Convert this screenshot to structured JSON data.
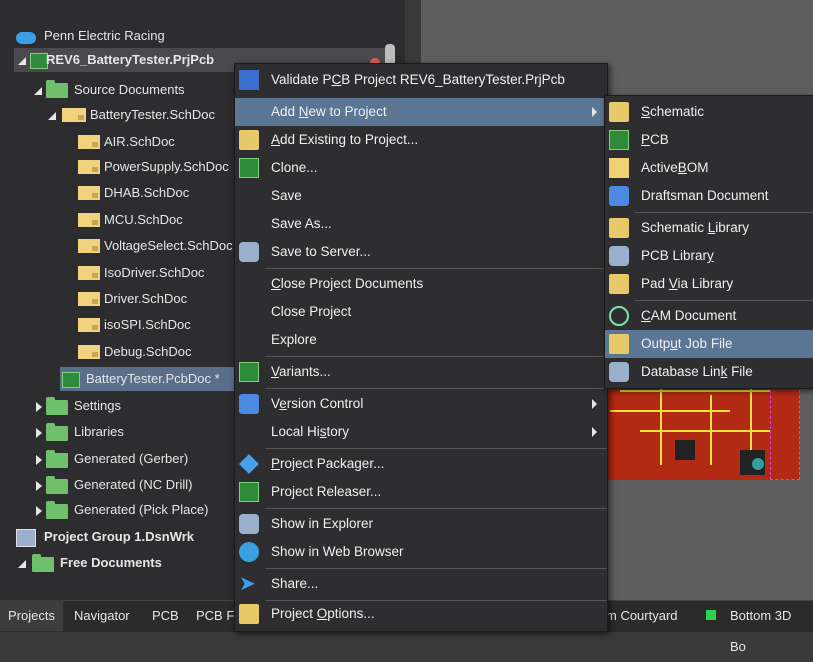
{
  "tree": {
    "workspace": "Penn Electric Racing",
    "project": "REV6_BatteryTester.PrjPcb",
    "source_documents": "Source Documents",
    "top_sheet": "BatteryTester.SchDoc",
    "sheets": [
      "AIR.SchDoc",
      "PowerSupply.SchDoc",
      "DHAB.SchDoc",
      "MCU.SchDoc",
      "VoltageSelect.SchDoc",
      "IsoDriver.SchDoc",
      "Driver.SchDoc",
      "isoSPI.SchDoc",
      "Debug.SchDoc"
    ],
    "pcb_doc": "BatteryTester.PcbDoc *",
    "folders": [
      "Settings",
      "Libraries",
      "Generated (Gerber)",
      "Generated (NC Drill)",
      "Generated (Pick Place)"
    ],
    "project_group": "Project Group 1.DsnWrk",
    "free_documents": "Free Documents"
  },
  "context_menu": {
    "items": [
      {
        "label_pre": "Validate P",
        "label_u": "C",
        "label_post": "B Project REV6_BatteryTester.PrjPcb",
        "icon": "validate-icon"
      },
      {
        "label_pre": "Add ",
        "label_u": "N",
        "label_post": "ew to Project",
        "icon": "",
        "submenu": true
      },
      {
        "label_pre": "",
        "label_u": "A",
        "label_post": "dd Existing to Project...",
        "icon": "add-existing-icon"
      },
      {
        "label_pre": "",
        "label_u": "",
        "label_post": "Clone...",
        "icon": "clone-icon"
      },
      {
        "label_pre": "",
        "label_u": "",
        "label_post": "Save",
        "icon": ""
      },
      {
        "label_pre": "",
        "label_u": "",
        "label_post": "Save As...",
        "icon": ""
      },
      {
        "label_pre": "",
        "label_u": "",
        "label_post": "Save to Server...",
        "icon": "save-server-icon"
      },
      {
        "label_pre": "",
        "label_u": "C",
        "label_post": "lose Project Documents",
        "icon": ""
      },
      {
        "label_pre": "",
        "label_u": "",
        "label_post": "Close Project",
        "icon": ""
      },
      {
        "label_pre": "",
        "label_u": "",
        "label_post": "Explore",
        "icon": ""
      },
      {
        "label_pre": "",
        "label_u": "V",
        "label_post": "ariants...",
        "icon": "variants-icon"
      },
      {
        "label_pre": "V",
        "label_u": "e",
        "label_post": "rsion Control",
        "icon": "version-control-icon",
        "submenu": true
      },
      {
        "label_pre": "Local Hi",
        "label_u": "s",
        "label_post": "tory",
        "icon": "",
        "submenu": true
      },
      {
        "label_pre": "",
        "label_u": "P",
        "label_post": "roject Packager...",
        "icon": "packager-icon"
      },
      {
        "label_pre": "Project Releaser...",
        "label_u": "",
        "label_post": "",
        "icon": "releaser-icon"
      },
      {
        "label_pre": "Show in Explorer",
        "label_u": "",
        "label_post": "",
        "icon": "explorer-icon"
      },
      {
        "label_pre": "Show in Web Browser",
        "label_u": "",
        "label_post": "",
        "icon": "web-browser-icon"
      },
      {
        "label_pre": "Share...",
        "label_u": "",
        "label_post": "",
        "icon": "share-icon"
      },
      {
        "label_pre": "Project ",
        "label_u": "O",
        "label_post": "ptions...",
        "icon": "options-icon"
      }
    ]
  },
  "submenu": {
    "items": [
      {
        "label_pre": "",
        "label_u": "S",
        "label_post": "chematic",
        "icon": "schematic-icon"
      },
      {
        "label_pre": "",
        "label_u": "P",
        "label_post": "CB",
        "icon": "pcb-icon"
      },
      {
        "label_pre": "Active",
        "label_u": "B",
        "label_post": "OM",
        "icon": "activebom-icon"
      },
      {
        "label_pre": "Draftsman Document",
        "label_u": "",
        "label_post": "",
        "icon": "draftsman-icon"
      },
      {
        "label_pre": "Schematic ",
        "label_u": "L",
        "label_post": "ibrary",
        "icon": "schlib-icon"
      },
      {
        "label_pre": "PCB Librar",
        "label_u": "y",
        "label_post": "",
        "icon": "pcblib-icon"
      },
      {
        "label_pre": "Pad ",
        "label_u": "V",
        "label_post": "ia Library",
        "icon": "padvia-icon"
      },
      {
        "label_pre": "",
        "label_u": "C",
        "label_post": "AM Document",
        "icon": "cam-icon"
      },
      {
        "label_pre": "Outp",
        "label_u": "u",
        "label_post": "t Job File",
        "icon": "outjob-icon"
      },
      {
        "label_pre": "Database Lin",
        "label_u": "k",
        "label_post": " File",
        "icon": "dblink-icon"
      }
    ]
  },
  "bottom_tabs": [
    "Projects",
    "Navigator",
    "PCB",
    "PCB Fi"
  ],
  "bottom_layers": [
    "m Courtyard",
    "Bottom 3D Bo"
  ]
}
